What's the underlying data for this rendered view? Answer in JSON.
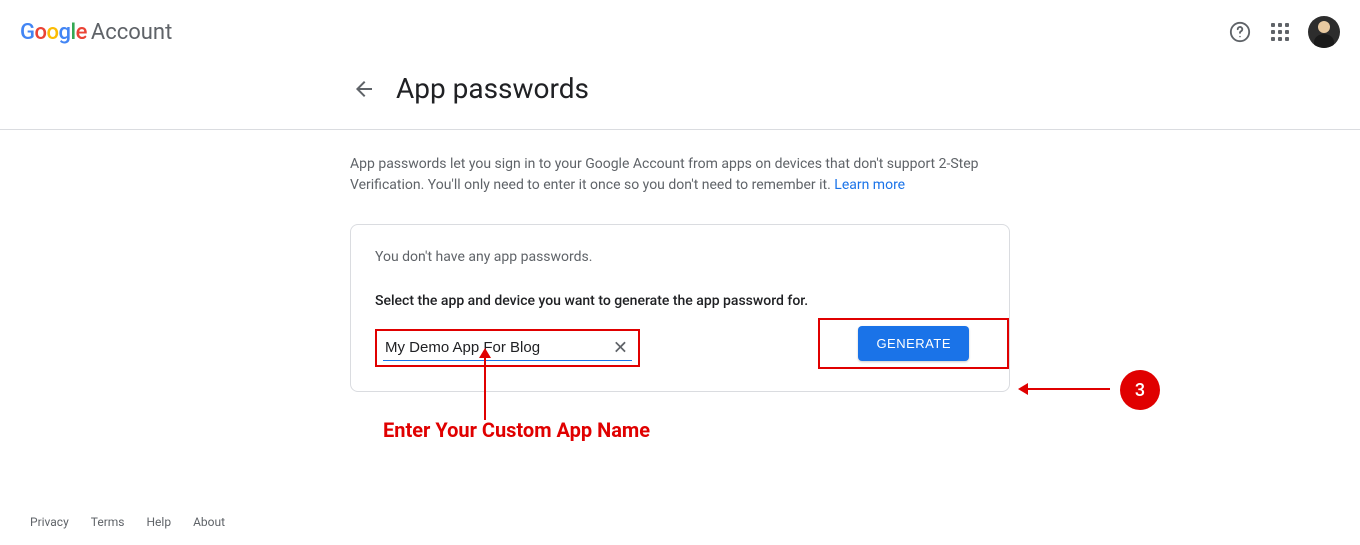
{
  "header": {
    "logo_word": "Google",
    "account_word": "Account"
  },
  "page": {
    "title": "App passwords",
    "description_text": "App passwords let you sign in to your Google Account from apps on devices that don't support 2-Step Verification. You'll only need to enter it once so you don't need to remember it. ",
    "learn_more": "Learn more"
  },
  "card": {
    "no_passwords_text": "You don't have any app passwords.",
    "select_label": "Select the app and device you want to generate the app password for.",
    "input_value": "My Demo App For Blog",
    "generate_label": "GENERATE"
  },
  "annotations": {
    "custom_name_hint": "Enter Your Custom App Name",
    "step_number": "3"
  },
  "footer": {
    "privacy": "Privacy",
    "terms": "Terms",
    "help": "Help",
    "about": "About"
  }
}
